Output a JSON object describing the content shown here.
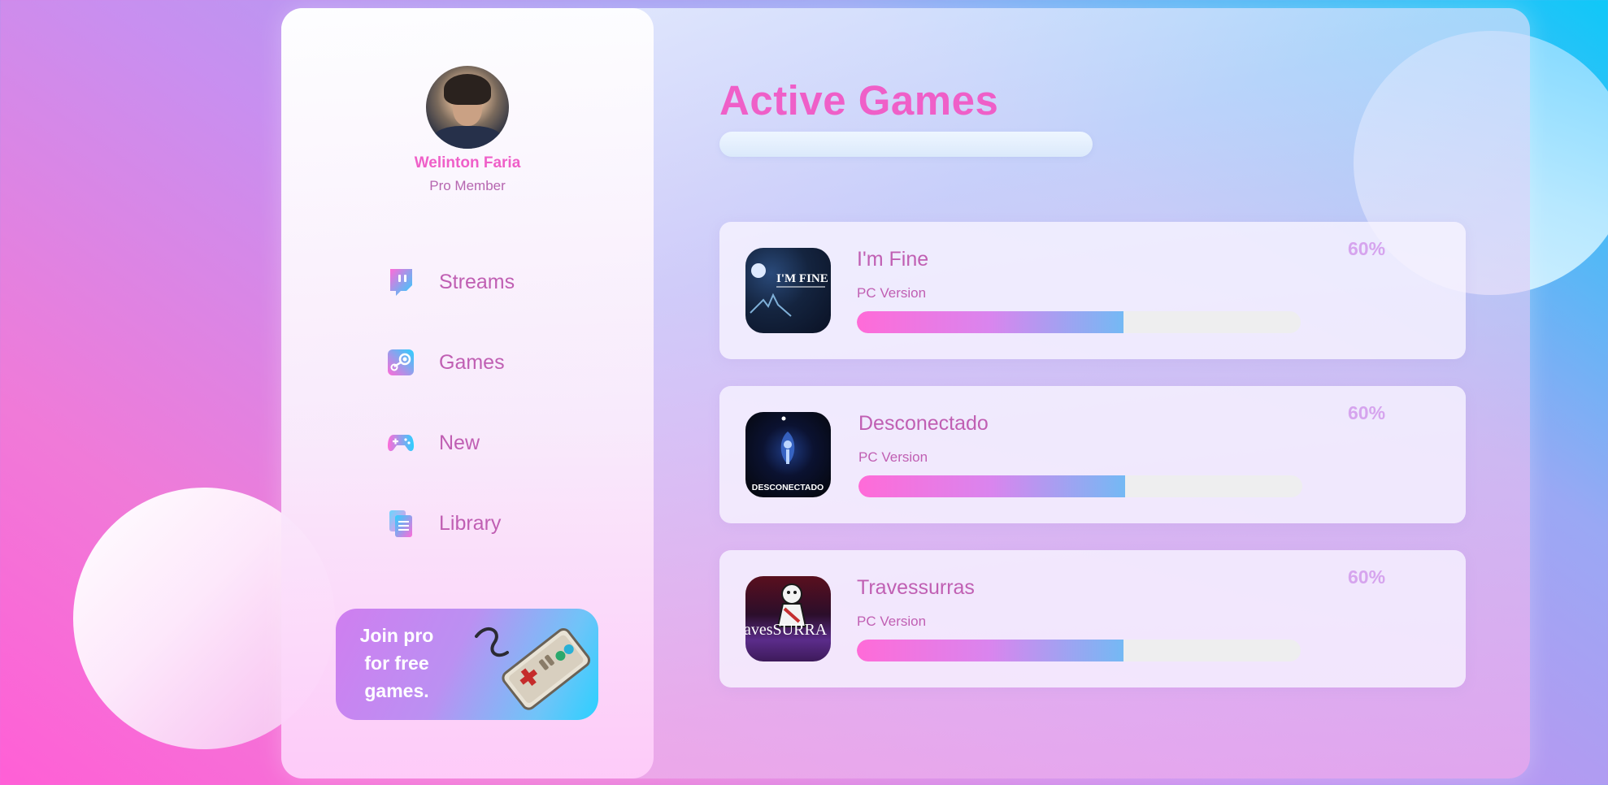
{
  "profile": {
    "name": "Welinton Faria",
    "tier": "Pro Member"
  },
  "nav": [
    {
      "label": "Streams",
      "icon": "twitch-icon"
    },
    {
      "label": "Games",
      "icon": "steam-icon"
    },
    {
      "label": "New",
      "icon": "gamepad-icon"
    },
    {
      "label": "Library",
      "icon": "library-icon"
    }
  ],
  "promo": {
    "line1": "Join pro",
    "line2": "for free",
    "line3": "games.",
    "art_icon": "retro-controller-icon"
  },
  "main": {
    "title": "Active Games",
    "games": [
      {
        "title": "I'm Fine",
        "platform": "PC Version",
        "progress": 60,
        "progress_label": "60%",
        "cover_text": "I'M FINE"
      },
      {
        "title": "Desconectado",
        "platform": "PC Version",
        "progress": 60,
        "progress_label": "60%",
        "cover_text": "DESCONECTADO"
      },
      {
        "title": "Travessurras",
        "platform": "PC Version",
        "progress": 60,
        "progress_label": "60%",
        "cover_text": "avesSURRA"
      }
    ]
  },
  "colors": {
    "accent": "#ef5fc8",
    "text": "#c05fb3",
    "percent": "#d6a4ee",
    "progress_start": "#ff6bd8",
    "progress_end": "#74b9f4"
  }
}
